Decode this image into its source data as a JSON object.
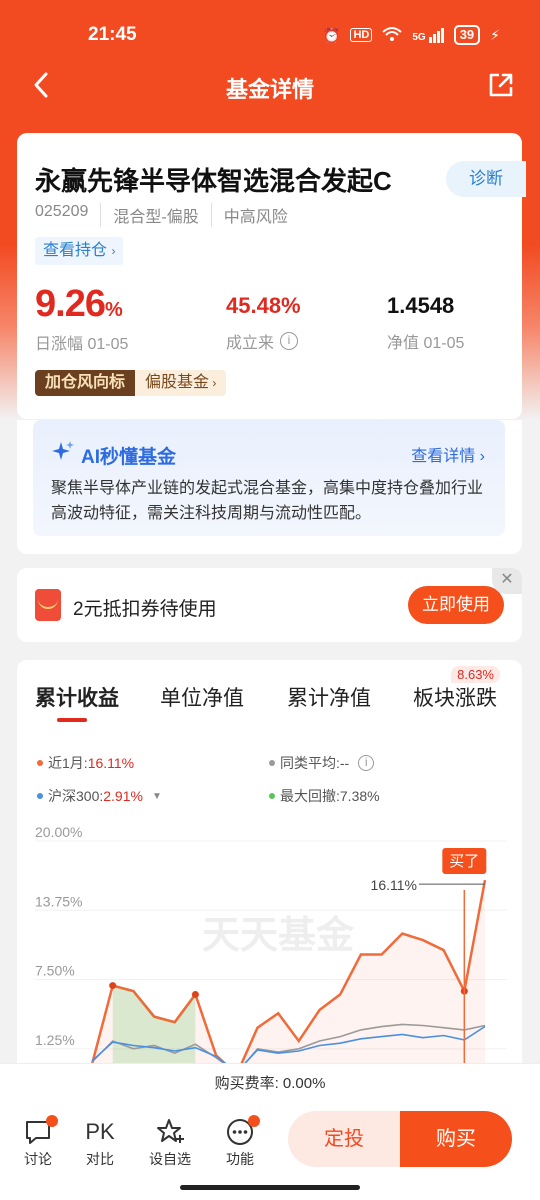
{
  "status_bar": {
    "time": "21:45",
    "hd": "HD",
    "network": "5G",
    "battery": "39"
  },
  "nav": {
    "title": "基金详情",
    "back_icon": "back-arrow-icon",
    "share_icon": "share-icon"
  },
  "fund": {
    "name": "永赢先锋半导体智选混合发起C",
    "diagnose_label": "诊断",
    "code": "025209",
    "type": "混合型-偏股",
    "risk": "中高风险",
    "holdings_label": "查看持仓",
    "daily_change_value": "9.26",
    "daily_change_unit": "%",
    "daily_change_label": "日涨幅 01-05",
    "since_inception_value": "45.48%",
    "since_inception_label": "成立来",
    "nav_value": "1.4548",
    "nav_label": "净值 01-05",
    "tag_dark": "加仓风向标",
    "tag_light": "偏股基金"
  },
  "ai": {
    "title": "AI秒懂基金",
    "more_label": "查看详情",
    "text": "聚焦半导体产业链的发起式混合基金，高集中度持仓叠加行业高波动特征，需关注科技周期与流动性匹配。"
  },
  "coupon": {
    "text": "2元抵扣券待使用",
    "button_label": "立即使用",
    "close": "✕"
  },
  "chart_tabs": {
    "items": [
      "累计收益",
      "单位净值",
      "累计净值",
      "板块涨跌"
    ],
    "badge": "8.63%"
  },
  "legend": {
    "month_label": "近1月:",
    "month_value": "16.11%",
    "peer_label": "同类平均:",
    "peer_value": "--",
    "hs300_label": "沪深300:",
    "hs300_value": "2.91%",
    "drawdown_label": "最大回撤:",
    "drawdown_value": "7.38%"
  },
  "chart_data": {
    "type": "line",
    "y_ticks": [
      "20.00%",
      "13.75%",
      "7.50%",
      "1.25%"
    ],
    "ylim": [
      0,
      20
    ],
    "watermark": "天天基金",
    "end_label": "16.11%",
    "buy_marker": "买了",
    "series": [
      {
        "color": "#f06a3a",
        "values": [
          -0.5,
          6.6,
          6.1,
          3.8,
          3.3,
          5.8,
          0.3,
          -1.4,
          2.8,
          4.1,
          1.6,
          4.4,
          5.8,
          9.4,
          9.4,
          11.3,
          10.7,
          9.8,
          6.1,
          16.11
        ]
      },
      {
        "color": "#9a9a9a",
        "values": [
          -0.3,
          1.6,
          0.9,
          1.2,
          0.5,
          1.3,
          0.1,
          -1.3,
          0.9,
          0.6,
          0.9,
          1.6,
          2.0,
          2.6,
          2.9,
          3.1,
          3.0,
          2.8,
          2.6,
          3.0
        ]
      },
      {
        "color": "#4a90e2",
        "values": [
          -0.2,
          1.5,
          1.2,
          1.0,
          0.7,
          1.0,
          0.2,
          -1.2,
          0.8,
          0.5,
          0.7,
          1.2,
          1.4,
          1.8,
          2.0,
          2.2,
          1.9,
          2.1,
          1.7,
          2.91
        ]
      }
    ]
  },
  "fee": {
    "text": "购买费率: 0.00%"
  },
  "bottom": {
    "discuss": "讨论",
    "compare_icon": "PK",
    "compare": "对比",
    "watchlist": "设自选",
    "function": "功能",
    "dingtou": "定投",
    "buy": "购买"
  }
}
